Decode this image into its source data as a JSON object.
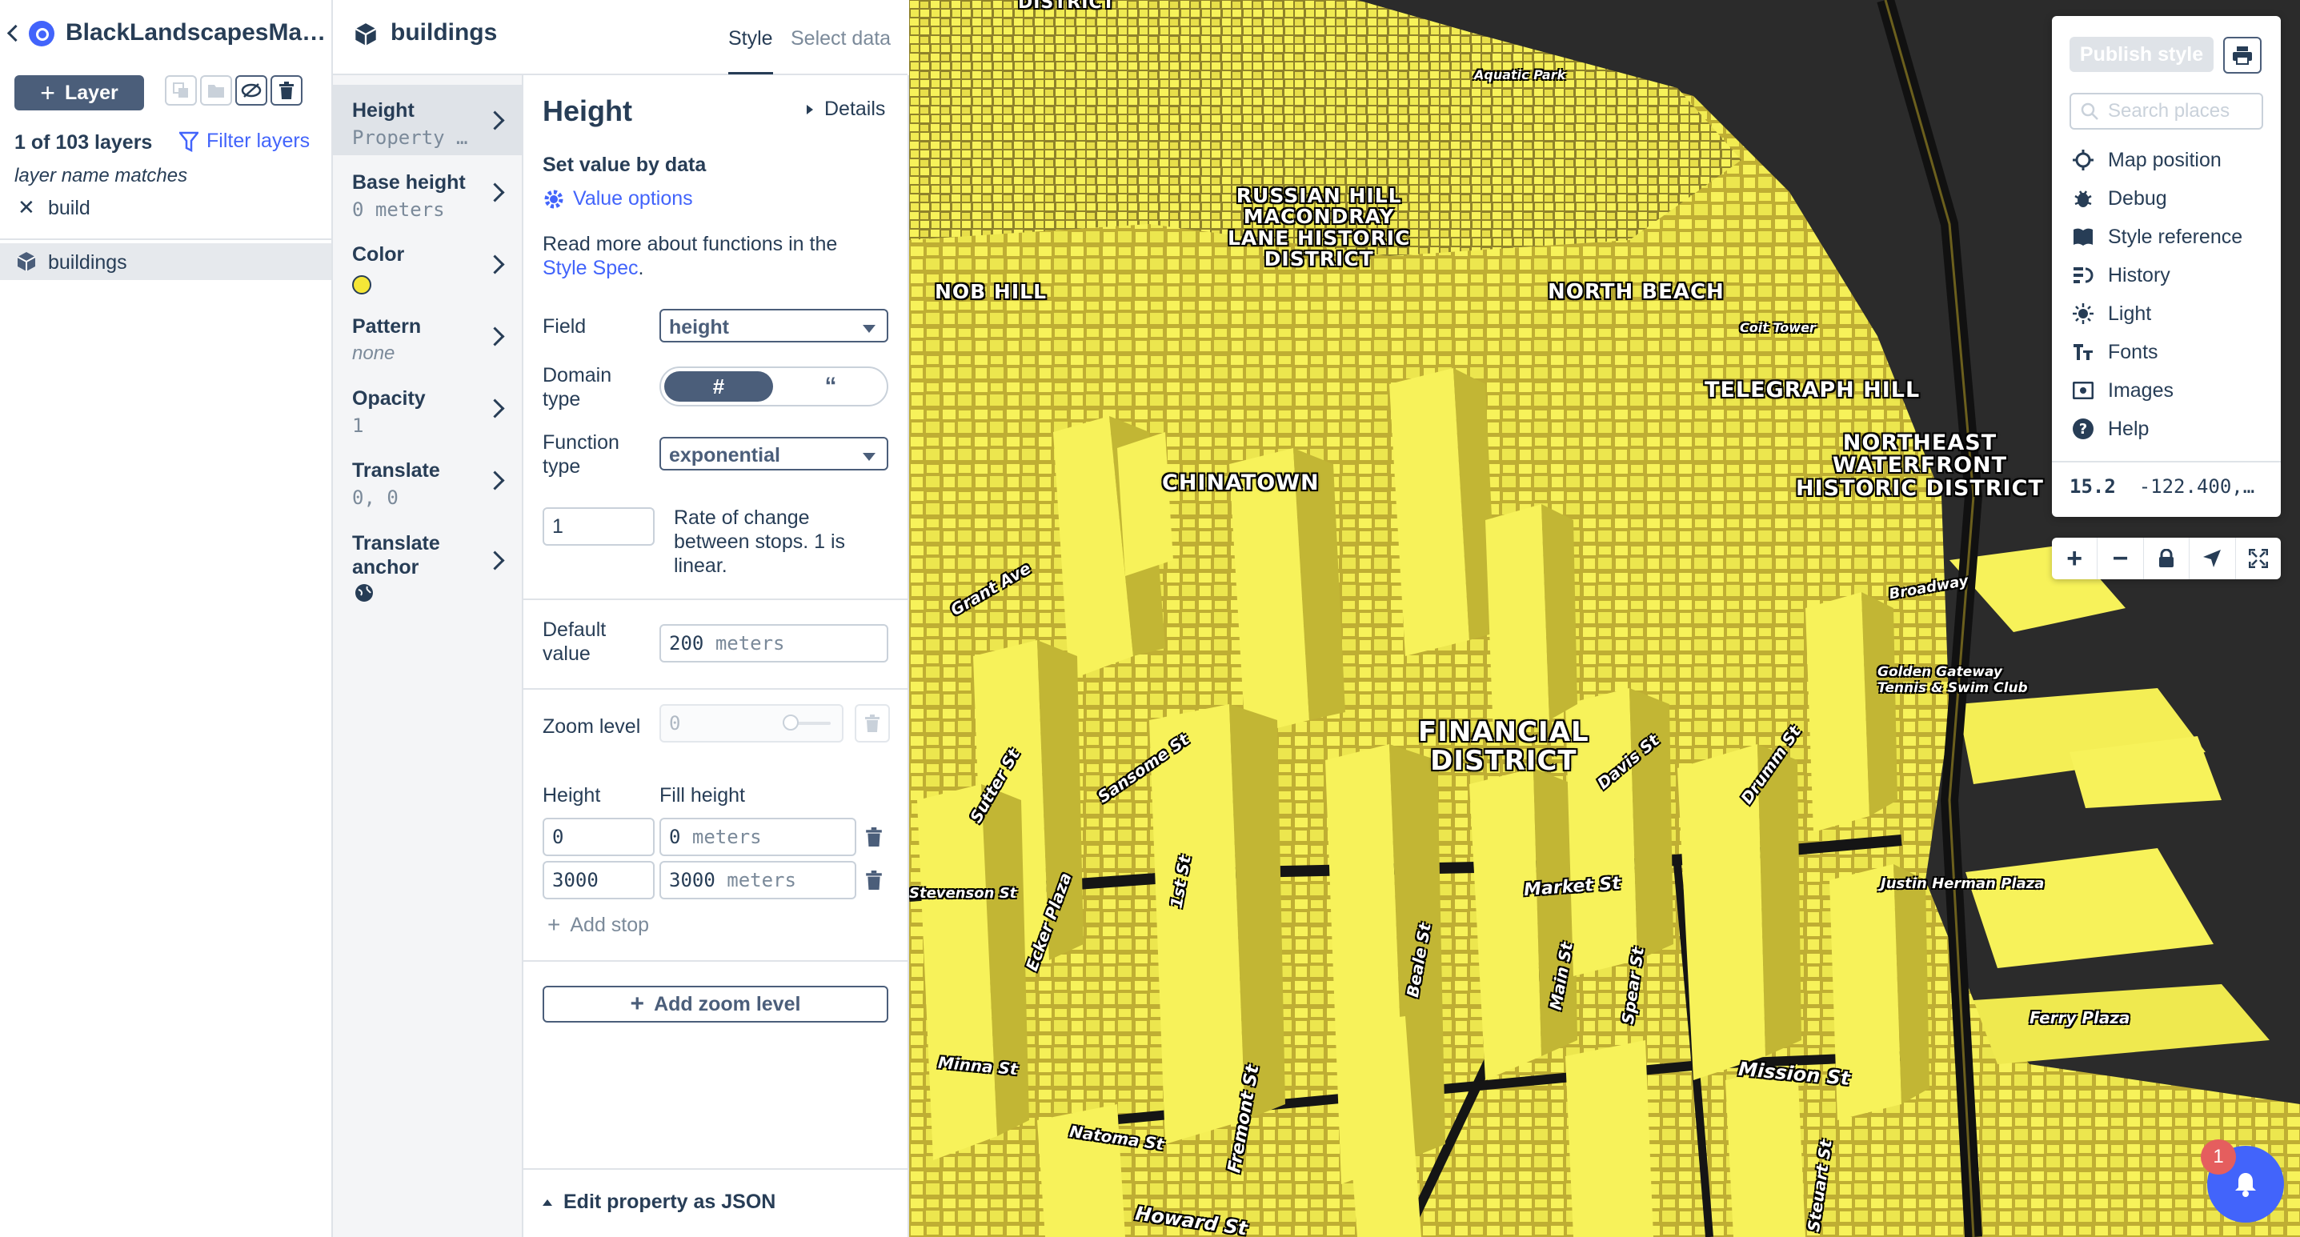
{
  "app": {
    "project_title": "BlackLandscapesMa…",
    "layer_button": "Layer",
    "layers_count": "1 of 103 layers",
    "filter_layers": "Filter layers",
    "filter_label": "layer name matches",
    "filter_value": "build",
    "layers": [
      {
        "name": "buildings",
        "selected": true
      }
    ]
  },
  "layer_header": {
    "name": "buildings",
    "tabs": [
      "Style",
      "Select data"
    ],
    "active_tab": "Style"
  },
  "properties": [
    {
      "name": "Height",
      "value": "Property …"
    },
    {
      "name": "Base height",
      "value": "0",
      "unit": "meters"
    },
    {
      "name": "Color",
      "value": "",
      "swatch": "#f5e637"
    },
    {
      "name": "Pattern",
      "value": "none"
    },
    {
      "name": "Opacity",
      "value": "1"
    },
    {
      "name": "Translate",
      "value": "0, 0"
    },
    {
      "name": "Translate anchor",
      "value": ""
    }
  ],
  "editor": {
    "title": "Height",
    "details": "Details",
    "set_value_by": "Set value by data",
    "value_options": "Value options",
    "read_more": "Read more about functions in the",
    "style_spec": "Style Spec",
    "period": ".",
    "field_label": "Field",
    "field_value": "height",
    "domain_label": "Domain type",
    "domain_options": [
      "#",
      "“"
    ],
    "function_label": "Function type",
    "function_value": "exponential",
    "rate_value": "1",
    "rate_desc": "Rate of change between stops. 1 is linear.",
    "default_label": "Default value",
    "default_value": "200",
    "default_unit": "meters",
    "zoom_label": "Zoom level",
    "zoom_value": "0",
    "col_height": "Height",
    "col_fill": "Fill height",
    "stops": [
      {
        "input": "0",
        "output": "0",
        "unit": "meters"
      },
      {
        "input": "3000",
        "output": "3000",
        "unit": "meters"
      }
    ],
    "add_stop": "Add stop",
    "add_zoom_level": "Add zoom level",
    "edit_json": "Edit property as JSON"
  },
  "map": {
    "neighborhoods": [
      "DISTRICT",
      "RUSSIAN HILL\nMACONDRAY\nLANE HISTORIC\nDISTRICT",
      "NOB HILL",
      "NORTH BEACH",
      "TELEGRAPH HILL",
      "NORTHEAST\nWATERFRONT\nHISTORIC DISTRICT",
      "CHINATOWN",
      "FINANCIAL\nDISTRICT"
    ],
    "streets": [
      "Aquatic Park",
      "Coit Tower",
      "Grant Ave",
      "Sansome St",
      "Davis St",
      "Drumm St",
      "1st St",
      "Ecker Plaza",
      "Beale St",
      "Main St",
      "Spear St",
      "Market St",
      "Mission St",
      "Fremont St",
      "Minna St",
      "Natoma St",
      "Howard St",
      "Steuart St",
      "Ferry Plaza",
      "Golden Gateway\nTennis & Swim Club",
      "Justin Herman Plaza",
      "Broadway",
      "Stevenson St",
      "Sutter St"
    ],
    "colors": {
      "building": "#f7f25a",
      "building_side": "#c9bd3a",
      "ground": "#2b2b2b",
      "water": "#2f2f2f"
    }
  },
  "map_menu": {
    "publish": "Publish style",
    "search_placeholder": "Search places",
    "items": [
      {
        "label": "Map position",
        "icon": "crosshair-icon"
      },
      {
        "label": "Debug",
        "icon": "bug-icon"
      },
      {
        "label": "Style reference",
        "icon": "book-icon"
      },
      {
        "label": "History",
        "icon": "history-icon"
      },
      {
        "label": "Light",
        "icon": "sun-icon"
      },
      {
        "label": "Fonts",
        "icon": "text-icon"
      },
      {
        "label": "Images",
        "icon": "image-icon"
      },
      {
        "label": "Help",
        "icon": "help-icon"
      }
    ],
    "zoom": "15.2",
    "coords": "-122.400,…",
    "notification_count": "1"
  }
}
